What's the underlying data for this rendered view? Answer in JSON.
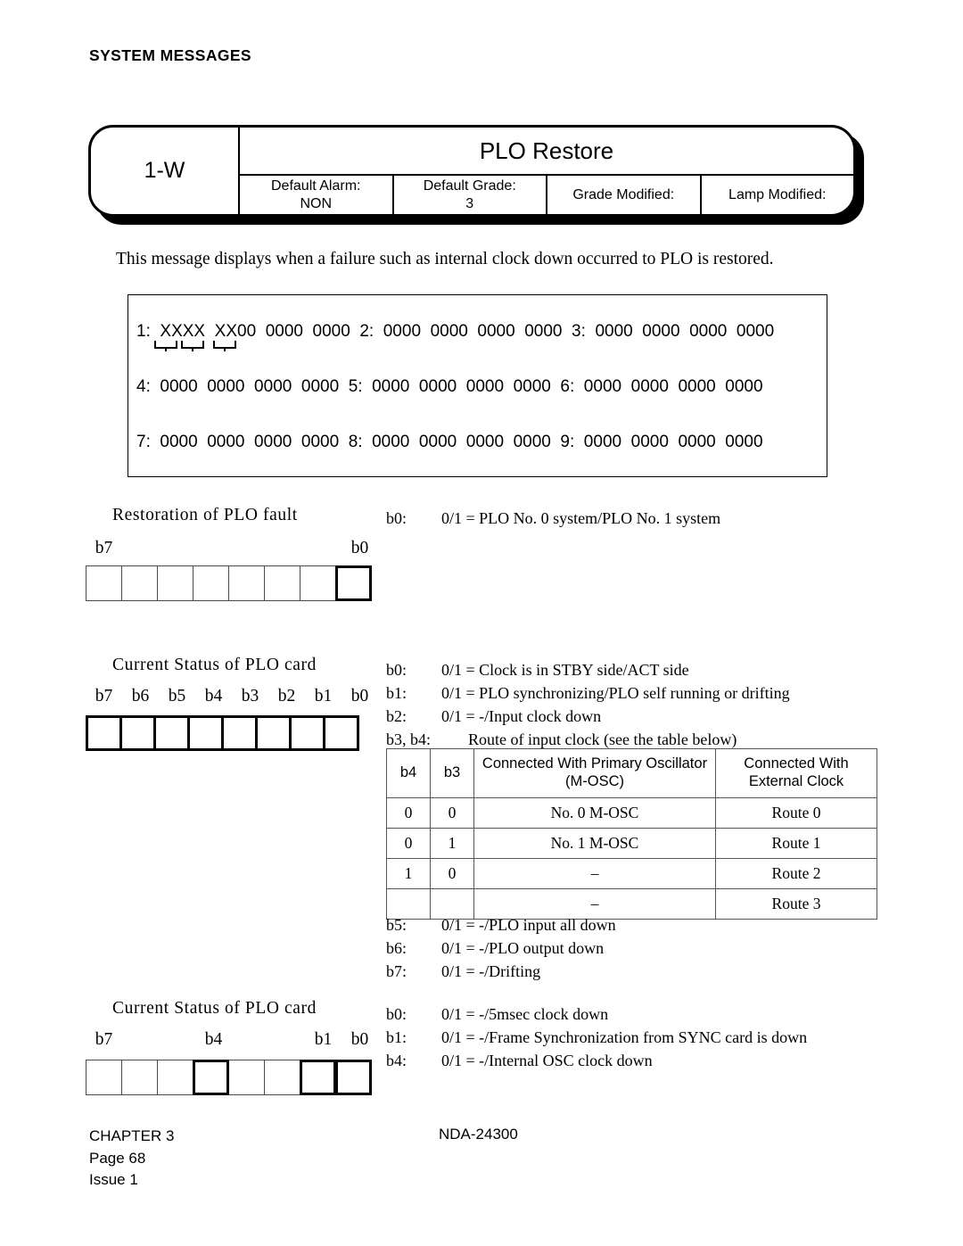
{
  "header": {
    "running_title": "SYSTEM MESSAGES"
  },
  "banner": {
    "code": "1-W",
    "title": "PLO Restore",
    "fields": [
      {
        "label": "Default Alarm:",
        "value": "NON"
      },
      {
        "label": "Default Grade:",
        "value": "3"
      },
      {
        "label": "Grade Modified:",
        "value": ""
      },
      {
        "label": "Lamp Modified:",
        "value": ""
      }
    ]
  },
  "description": "This message displays when a failure such as internal clock down occurred to PLO is restored.",
  "data_box": {
    "lines": [
      "1:  XXXX  XX00  0000  0000  2:  0000  0000  0000  0000  3:  0000  0000  0000  0000",
      "4:  0000  0000  0000  0000  5:  0000  0000  0000  0000  6:  0000  0000  0000  0000",
      "7:  0000  0000  0000  0000  8:  0000  0000  0000  0000  9:  0000  0000  0000  0000"
    ]
  },
  "sections": [
    {
      "title": "Restoration of PLO fault",
      "bit_labels": [
        "b7",
        "",
        "",
        "",
        "",
        "",
        "",
        "b0"
      ],
      "bold_cells": [
        7
      ],
      "notes": [
        {
          "key": "b0:",
          "value": "0/1 = PLO No. 0 system/PLO No. 1 system"
        }
      ]
    },
    {
      "title": "Current Status of PLO card",
      "bit_labels": [
        "b7",
        "b6",
        "b5",
        "b4",
        "b3",
        "b2",
        "b1",
        "b0"
      ],
      "bold_cells": [
        0,
        1,
        2,
        3,
        4,
        5,
        6,
        7
      ],
      "notes": [
        {
          "key": "b0:",
          "value": "0/1 = Clock is in STBY side/ACT side"
        },
        {
          "key": "b1:",
          "value": "0/1 = PLO synchronizing/PLO self running or drifting"
        },
        {
          "key": "b2:",
          "value": "0/1 = -/Input clock down"
        },
        {
          "key": "b3, b4:",
          "value": "Route of input clock (see the table below)",
          "wide": true
        }
      ],
      "notes_after": [
        {
          "key": "b5:",
          "value": "0/1 = -/PLO input all down"
        },
        {
          "key": "b6:",
          "value": "0/1 = -/PLO output down"
        },
        {
          "key": "b7:",
          "value": "0/1 = -/Drifting"
        }
      ]
    },
    {
      "title": "Current Status of PLO card",
      "bit_labels": [
        "b7",
        "",
        "",
        "b4",
        "",
        "",
        "b1",
        "b0"
      ],
      "bold_cells": [
        3,
        6,
        7
      ],
      "notes": [
        {
          "key": "b0:",
          "value": "0/1 = -/5msec clock down"
        },
        {
          "key": "b1:",
          "value": "0/1 = -/Frame Synchronization from SYNC card is down"
        },
        {
          "key": "b4:",
          "value": "0/1 = -/Internal OSC clock down"
        }
      ]
    }
  ],
  "route_table": {
    "headers": [
      "b4",
      "b3",
      "Connected With Primary Oscillator (M-OSC)",
      "Connected With External Clock"
    ],
    "rows": [
      [
        "0",
        "0",
        "No. 0 M-OSC",
        "Route 0"
      ],
      [
        "0",
        "1",
        "No. 1 M-OSC",
        "Route 1"
      ],
      [
        "1",
        "0",
        "–",
        "Route 2"
      ],
      [
        "",
        "",
        "–",
        "Route 3"
      ]
    ]
  },
  "footer": {
    "chapter": "CHAPTER 3",
    "page": "Page 68",
    "issue": "Issue 1",
    "document": "NDA-24300"
  }
}
